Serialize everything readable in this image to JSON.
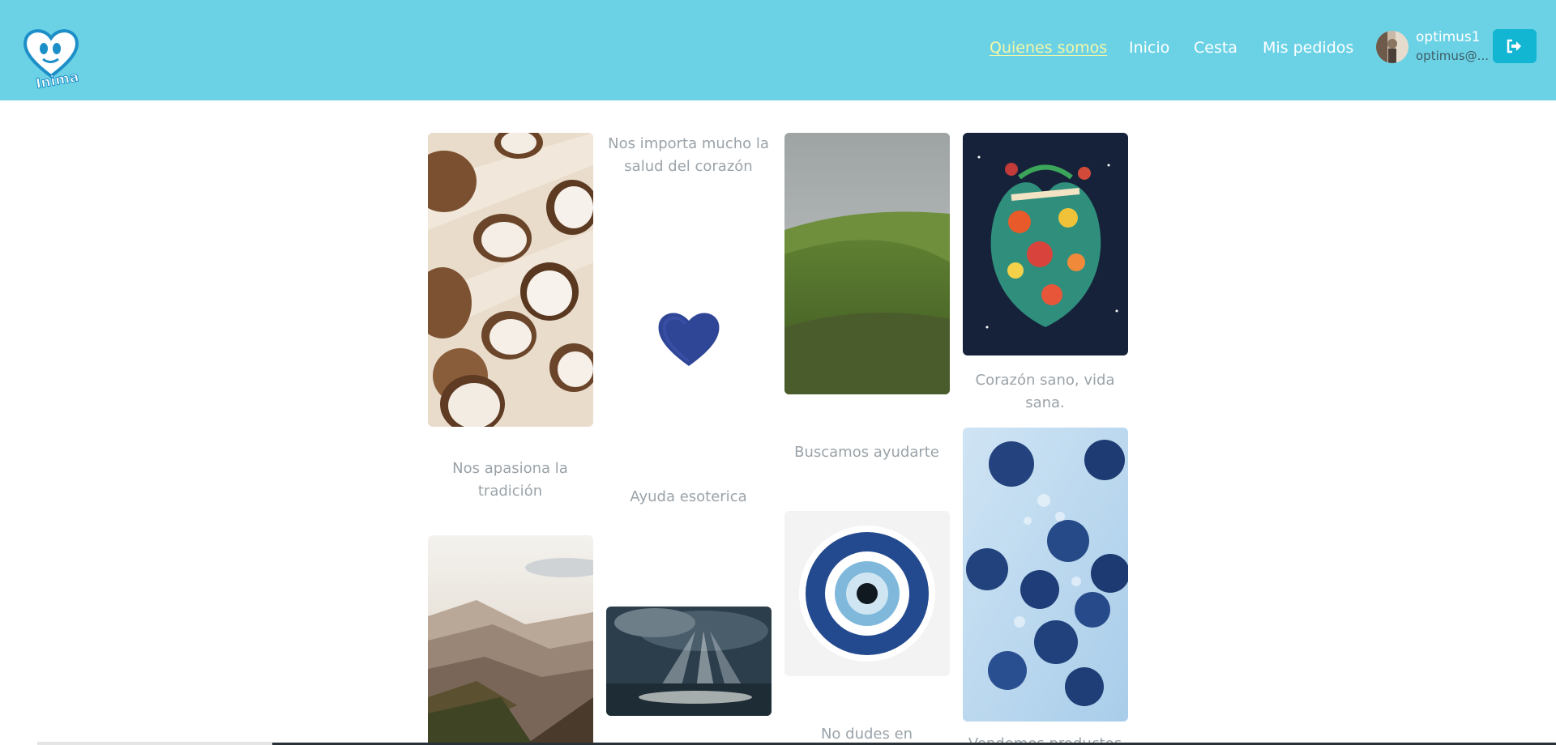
{
  "header": {
    "logo_text": "Inima",
    "nav": [
      {
        "label": "Quienes somos"
      },
      {
        "label": "Inicio"
      },
      {
        "label": "Cesta"
      },
      {
        "label": "Mis pedidos"
      }
    ],
    "user": {
      "name": "optimus1",
      "email": "optimus@..."
    }
  },
  "gallery": {
    "captions": {
      "corazon": "Nos importa mucho la salud del corazón",
      "sano": "Corazón sano, vida sana.",
      "tradicion": "Nos apasiona la tradición",
      "ayudarte": "Buscamos ayudarte",
      "esoterica": "Ayuda esoterica",
      "no_dudes": "No dudes en",
      "vendemos": "Vendemos productos"
    }
  },
  "colors": {
    "header": "#6bd2e6",
    "active_nav": "#f4f7a6",
    "logout": "#12b5d2",
    "caption": "#9aa3a9"
  }
}
